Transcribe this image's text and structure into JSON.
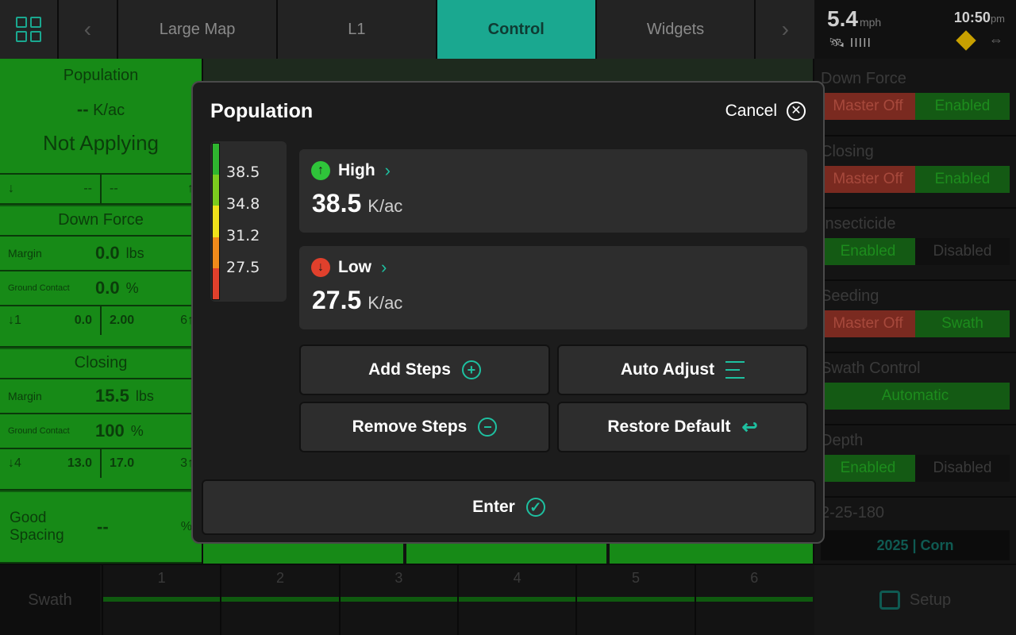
{
  "topnav": {
    "tabs": [
      {
        "label": "Large Map"
      },
      {
        "label": "L1"
      },
      {
        "label": "Control"
      },
      {
        "label": "Widgets"
      }
    ],
    "prev_arrow": "‹",
    "next_arrow": "›"
  },
  "status": {
    "speed": "5.4",
    "speed_unit": "mph",
    "time": "10:50",
    "time_suffix": "pm",
    "gps_bars": "IIIII",
    "swap_glyph": "⇔"
  },
  "left_panel": {
    "population": {
      "title": "Population",
      "value": "--",
      "unit": "K/ac",
      "state": "Not Applying",
      "min": "--",
      "max": "--",
      "min_value": "--"
    },
    "down_force": {
      "title": "Down Force",
      "margin_label": "Margin",
      "margin_value": "0.0",
      "margin_unit": "lbs",
      "gc_label": "Ground Contact",
      "gc_value": "0.0",
      "gc_unit": "%",
      "low_count": "1",
      "low_value": "0.0",
      "high_value": "2.00",
      "high_count": "6"
    },
    "closing": {
      "title": "Closing",
      "margin_label": "Margin",
      "margin_value": "15.5",
      "margin_unit": "lbs",
      "gc_label": "Ground Contact",
      "gc_value": "100",
      "gc_unit": "%",
      "low_count": "4",
      "low_value": "13.0",
      "high_value": "17.0",
      "high_count": "3"
    },
    "good_spacing": {
      "label": "Good Spacing",
      "value": "--",
      "unit": "%"
    }
  },
  "right_panel": {
    "down_force": {
      "title": "Down Force",
      "left": "Master Off",
      "right": "Enabled"
    },
    "closing": {
      "title": "Closing",
      "left": "Master Off",
      "right": "Enabled"
    },
    "insecticide": {
      "title": "Insecticide",
      "left": "Enabled",
      "right": "Disabled"
    },
    "seeding": {
      "title": "Seeding",
      "left": "Master Off",
      "right": "Swath"
    },
    "swath_control": {
      "title": "Swath Control",
      "value": "Automatic"
    },
    "depth": {
      "title": "Depth",
      "left": "Enabled",
      "right": "Disabled"
    },
    "code": "2-25-180",
    "season": "2025 | Corn"
  },
  "bottom": {
    "swath_label": "Swath",
    "rows": [
      "1",
      "2",
      "3",
      "4",
      "5",
      "6"
    ],
    "setup_label": "Setup"
  },
  "modal": {
    "title": "Population",
    "cancel_label": "Cancel",
    "legend": {
      "labels": [
        "38.5",
        "34.8",
        "31.2",
        "27.5"
      ],
      "colors": [
        "#2fb52f",
        "#7ccc1e",
        "#f0e21b",
        "#f08a1b",
        "#e0402c"
      ]
    },
    "high": {
      "label": "High",
      "value": "38.5",
      "unit": "K/ac",
      "color": "#2fc43a"
    },
    "low": {
      "label": "Low",
      "value": "27.5",
      "unit": "K/ac",
      "color": "#e0402c"
    },
    "buttons": {
      "add_steps": "Add Steps",
      "auto_adjust": "Auto Adjust",
      "remove_steps": "Remove Steps",
      "restore_default": "Restore Default",
      "enter": "Enter"
    },
    "accent": "#1ec0a0"
  }
}
